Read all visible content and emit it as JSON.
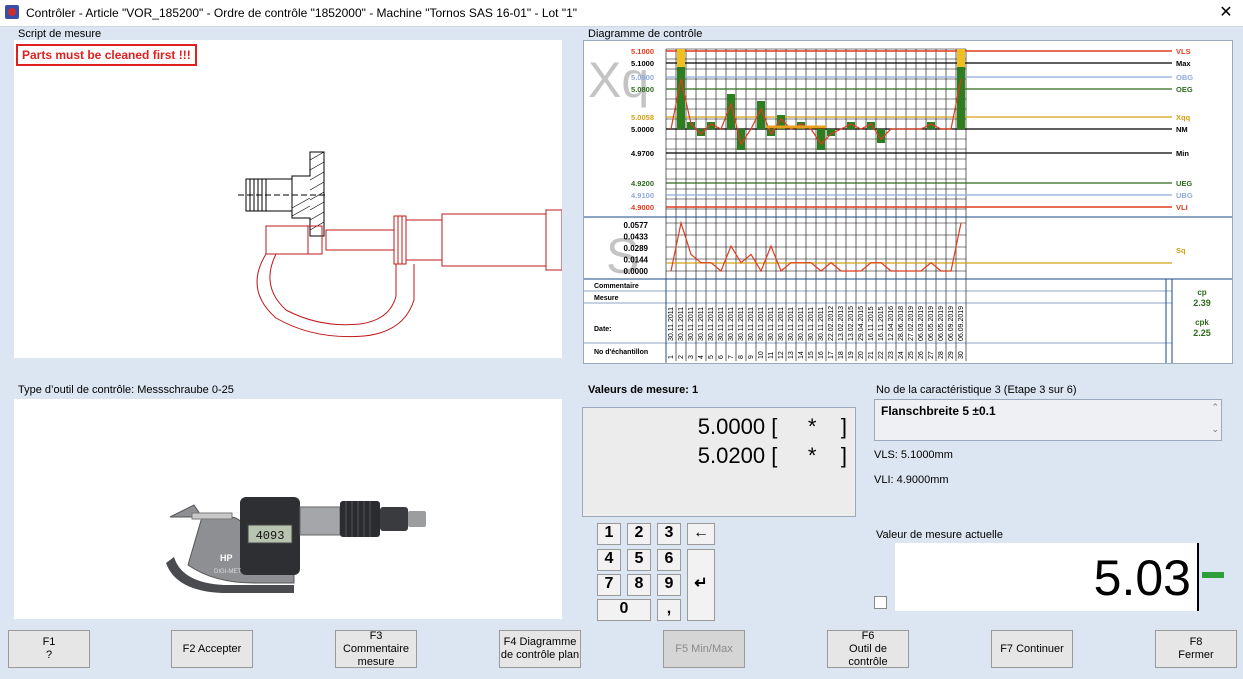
{
  "window": {
    "title": "Contrôler - Article \"VOR_185200\" - Ordre de contrôle \"1852000\" - Machine \"Tornos SAS 16-01\" - Lot \"1\""
  },
  "script": {
    "label": "Script de mesure",
    "warning": "Parts must be cleaned first !!!"
  },
  "diagram": {
    "label": "Diagramme de contrôle",
    "xq_label": "Xq",
    "s_label": "S",
    "left_values": [
      "5.1000",
      "5.1000",
      "5.0900",
      "5.0800",
      "5.0058",
      "5.0000",
      "4.9700",
      "4.9200",
      "4.9100",
      "4.9000"
    ],
    "right_labels": [
      "VLS",
      "Max",
      "OBG",
      "OEG",
      "Xqq",
      "NM",
      "Min",
      "UEG",
      "UBG",
      "VLI"
    ],
    "s_values": [
      "0.0577",
      "0.0433",
      "0.0289",
      "0.0144",
      "0.0000"
    ],
    "s_right": "Sq",
    "row_labels": {
      "commentaire": "Commentaire",
      "mesure": "Mesure",
      "date": "Date:",
      "echantillon": "No d'échantillon"
    },
    "dates": [
      "30.11.2011",
      "30.11.2011",
      "30.11.2011",
      "30.11.2011",
      "30.11.2011",
      "30.11.2011",
      "30.11.2011",
      "30.11.2011",
      "30.11.2011",
      "30.11.2011",
      "30.11.2011",
      "30.11.2011",
      "30.11.2011",
      "30.11.2011",
      "30.11.2011",
      "30.11.2011",
      "22.02.2012",
      "13.02.2013",
      "13.02.2015",
      "29.04.2015",
      "16.11.2015",
      "16.11.2015",
      "12.04.2016",
      "28.06.2018",
      "27.02.2019",
      "06.03.2019",
      "06.05.2019",
      "06.05.2019",
      "06.09.2019",
      "06.09.2019"
    ],
    "samples": [
      "1",
      "2",
      "3",
      "4",
      "5",
      "6",
      "7",
      "8",
      "9",
      "10",
      "11",
      "12",
      "13",
      "14",
      "15",
      "16",
      "17",
      "18",
      "19",
      "20",
      "21",
      "22",
      "23",
      "24",
      "25",
      "26",
      "27",
      "28",
      "29",
      "30"
    ],
    "cp_label": "cp",
    "cp_value": "2.39",
    "cpk_label": "cpk",
    "cpk_value": "2.25",
    "colors": {
      "vls": "#e03a1e",
      "max": "#000000",
      "obg": "#8faadc",
      "oeg": "#2e6b1e",
      "xqq": "#d4a017",
      "bar": "#2e7d1e",
      "orange": "#e8a020"
    }
  },
  "tool": {
    "label": "Type d’outil de contrôle: Messschraube 0-25",
    "display": "4093",
    "brand": "HP",
    "model": "DIGI-MET"
  },
  "measures": {
    "label": "Valeurs de mesure: 1",
    "rows": [
      "5.0000 [     *    ]",
      "5.0200 [     *    ]"
    ]
  },
  "keypad": {
    "keys": [
      "1",
      "2",
      "3",
      "←",
      "4",
      "5",
      "6",
      "7",
      "8",
      "9",
      "0",
      ","
    ],
    "enter": "↵"
  },
  "characteristic": {
    "label": "No de la caractéristique 3 (Etape 3 sur 6)",
    "name": "Flanschbreite 5 ±0.1",
    "vls": "VLS: 5.1000mm",
    "vli": "VLI: 4.9000mm"
  },
  "current": {
    "label": "Valeur de mesure actuelle",
    "value": "5.03"
  },
  "fkeys": [
    {
      "line1": "F1",
      "line2": "?"
    },
    {
      "line1": "F2 Accepter",
      "line2": ""
    },
    {
      "line1": "F3 Commentaire",
      "line2": "mesure"
    },
    {
      "line1": "F4 Diagramme",
      "line2": "de contrôle plan"
    },
    {
      "line1": "F5 Min/Max",
      "line2": ""
    },
    {
      "line1": "F6",
      "line2": "Outil de contrôle"
    },
    {
      "line1": "F7 Continuer",
      "line2": ""
    },
    {
      "line1": "F8",
      "line2": "Fermer"
    }
  ],
  "chart_data": {
    "type": "bar",
    "categories": [
      "1",
      "2",
      "3",
      "4",
      "5",
      "6",
      "7",
      "8",
      "9",
      "10",
      "11",
      "12",
      "13",
      "14",
      "15",
      "16",
      "17",
      "18",
      "19",
      "20",
      "21",
      "22",
      "23",
      "24",
      "25",
      "26",
      "27",
      "28",
      "29",
      "30"
    ],
    "series": [
      {
        "name": "Xq",
        "values": [
          5.0,
          5.1,
          5.01,
          4.99,
          5.01,
          5.0,
          5.05,
          4.97,
          5.0,
          5.04,
          4.99,
          5.02,
          5.0,
          5.01,
          5.0,
          4.97,
          4.99,
          5.0,
          5.01,
          5.0,
          5.01,
          4.98,
          5.0,
          5.0,
          5.0,
          5.0,
          5.01,
          5.0,
          5.0,
          5.1
        ]
      },
      {
        "name": "S",
        "values": [
          0.0,
          0.0577,
          0.02,
          0.01,
          0.01,
          0.0,
          0.03,
          0.01,
          0.02,
          0.0,
          0.03,
          0.0,
          0.01,
          0.01,
          0.01,
          0.0,
          0.01,
          0.0,
          0.0,
          0.0,
          0.01,
          0.01,
          0.0,
          0.0,
          0.0,
          0.0,
          0.01,
          0.0,
          0.0,
          0.0577
        ]
      }
    ],
    "ylim": [
      4.9,
      5.1
    ],
    "s_ylim": [
      0.0,
      0.0577
    ]
  }
}
